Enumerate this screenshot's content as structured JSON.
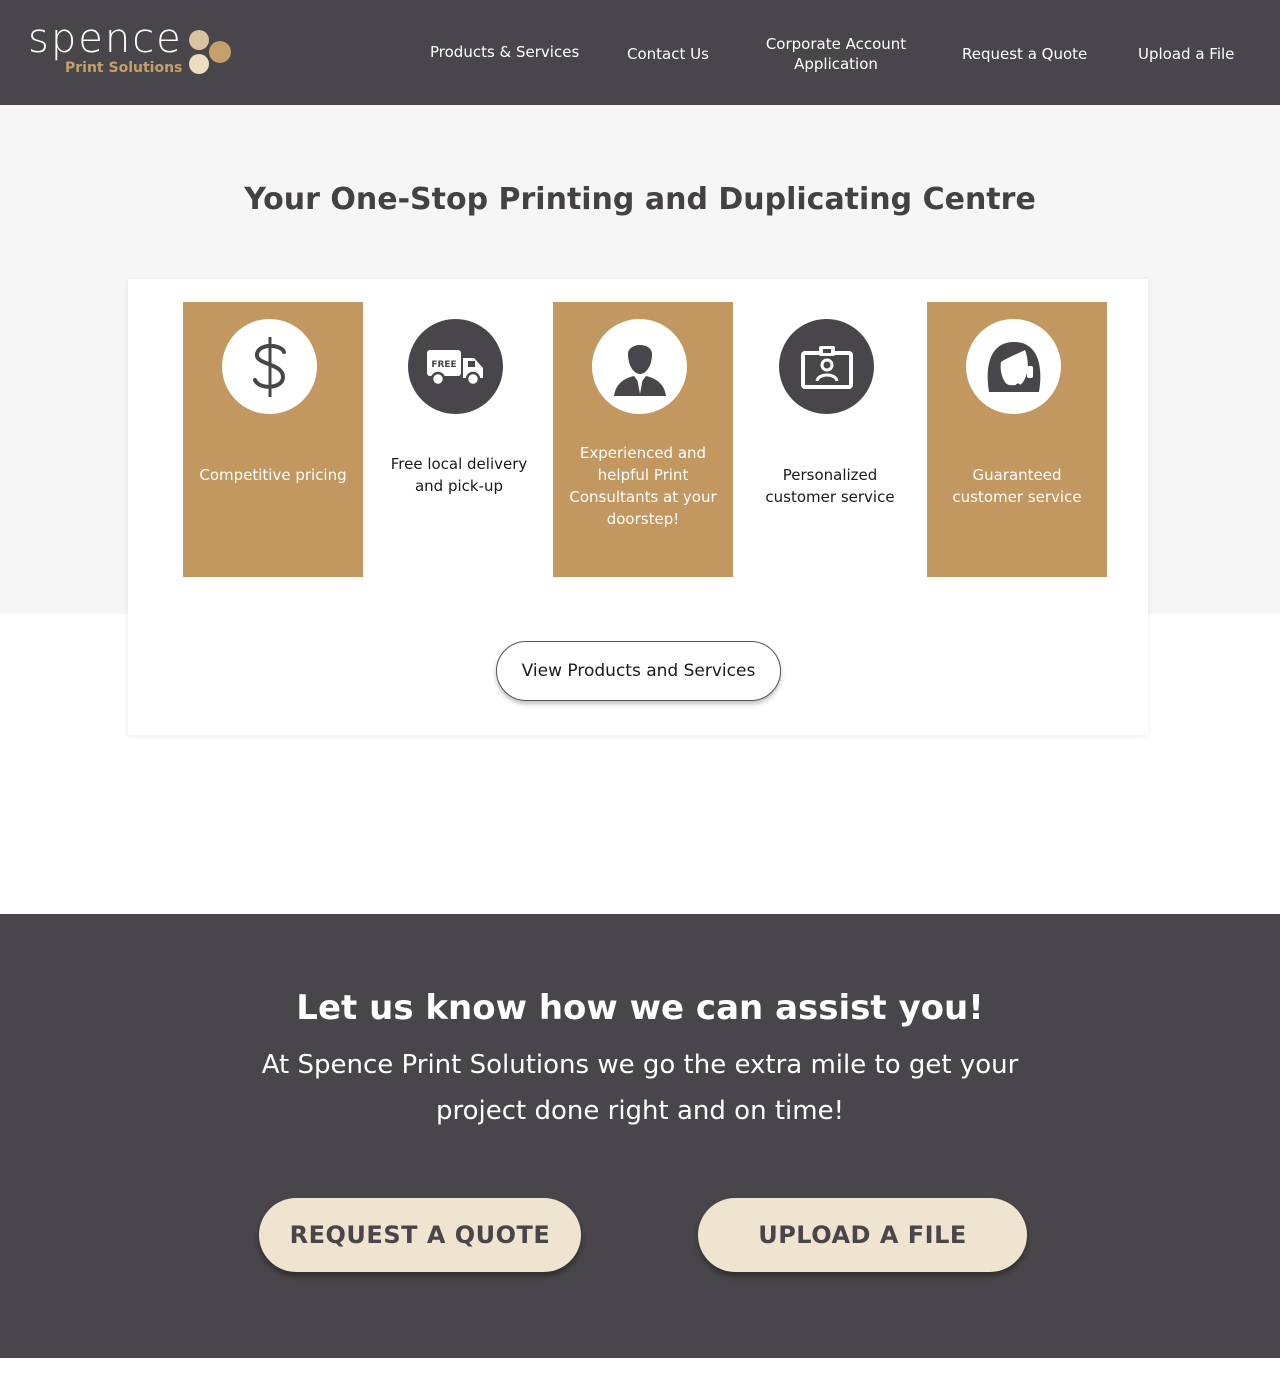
{
  "brand": {
    "wordmark": "spence",
    "subtitle": "Print Solutions",
    "dot_colors": [
      "#d9c2a0",
      "#c5a06a",
      "#ecdcc0"
    ]
  },
  "nav": {
    "items": [
      {
        "label": "Products & Services"
      },
      {
        "label": "Contact Us"
      },
      {
        "label": "Corporate Account Application"
      },
      {
        "label": "Request a Quote"
      },
      {
        "label": "Upload a File"
      }
    ]
  },
  "hero": {
    "title": "Your One-Stop Printing and Duplicating Centre"
  },
  "features": [
    {
      "icon": "dollar-icon",
      "text": "Competitive pricing",
      "style": "tan"
    },
    {
      "icon": "free-delivery-truck-icon",
      "icon_text": "FREE",
      "text": "Free local delivery and pick-up",
      "style": "plain"
    },
    {
      "icon": "consultant-person-icon",
      "text": "Experienced and helpful Print Consultants at your doorstep!",
      "style": "tan"
    },
    {
      "icon": "id-badge-icon",
      "text": "Personalized customer service",
      "style": "plain"
    },
    {
      "icon": "support-headset-icon",
      "text": "Guaranteed customer service",
      "style": "tan"
    }
  ],
  "view_button": {
    "label": "View Products and Services"
  },
  "cta": {
    "title": "Let us know how we can assist you!",
    "text": "At Spence Print Solutions we go the extra mile to get your project done right and on time!",
    "quote_button": "REQUEST A QUOTE",
    "upload_button": "UPLOAD A FILE"
  },
  "colors": {
    "header_bg": "#48464a",
    "accent_tan": "#c39760",
    "button_cream": "#efe4cf",
    "hero_bg": "#f6f6f6"
  }
}
